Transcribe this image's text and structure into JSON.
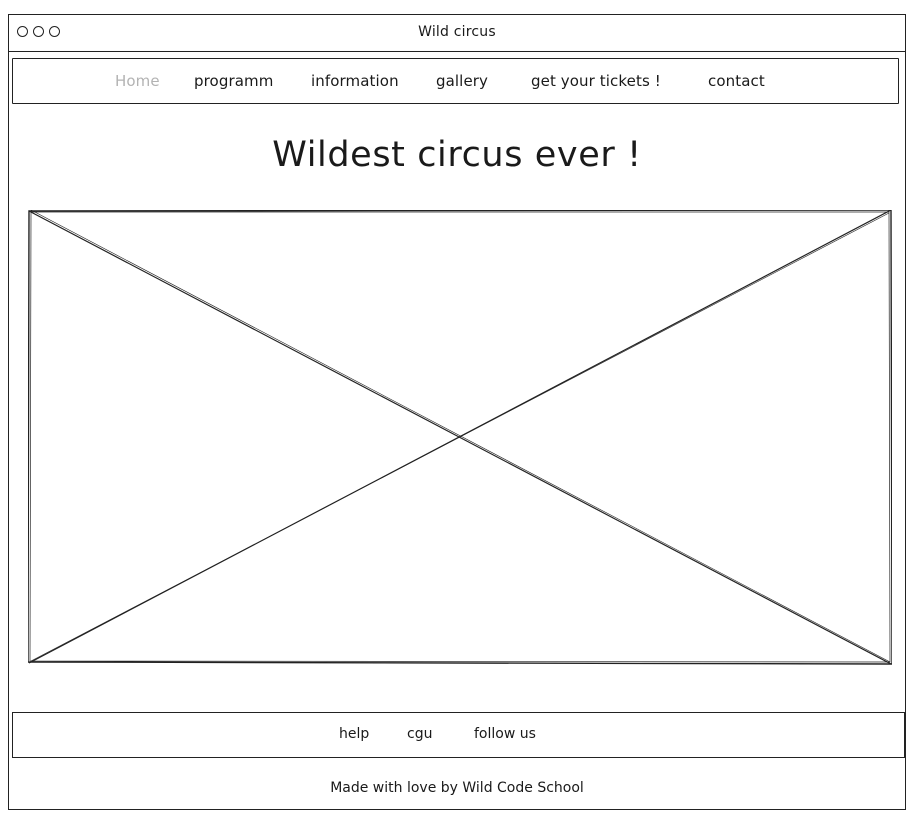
{
  "window": {
    "title": "Wild circus"
  },
  "nav": {
    "items": [
      {
        "label": "Home",
        "active": true
      },
      {
        "label": "programm",
        "active": false
      },
      {
        "label": "information",
        "active": false
      },
      {
        "label": "gallery",
        "active": false
      },
      {
        "label": "get your tickets !",
        "active": false
      },
      {
        "label": "contact",
        "active": false
      }
    ]
  },
  "main": {
    "headline": "Wildest circus ever !",
    "hero_image_icon": "image-placeholder-icon"
  },
  "footer": {
    "links": [
      {
        "label": "help"
      },
      {
        "label": "cgu"
      },
      {
        "label": "follow us"
      }
    ],
    "credits": "Made with love by Wild Code School"
  },
  "colors": {
    "stroke": "#222222",
    "active_nav": "#b3b3b3",
    "background": "#ffffff"
  }
}
